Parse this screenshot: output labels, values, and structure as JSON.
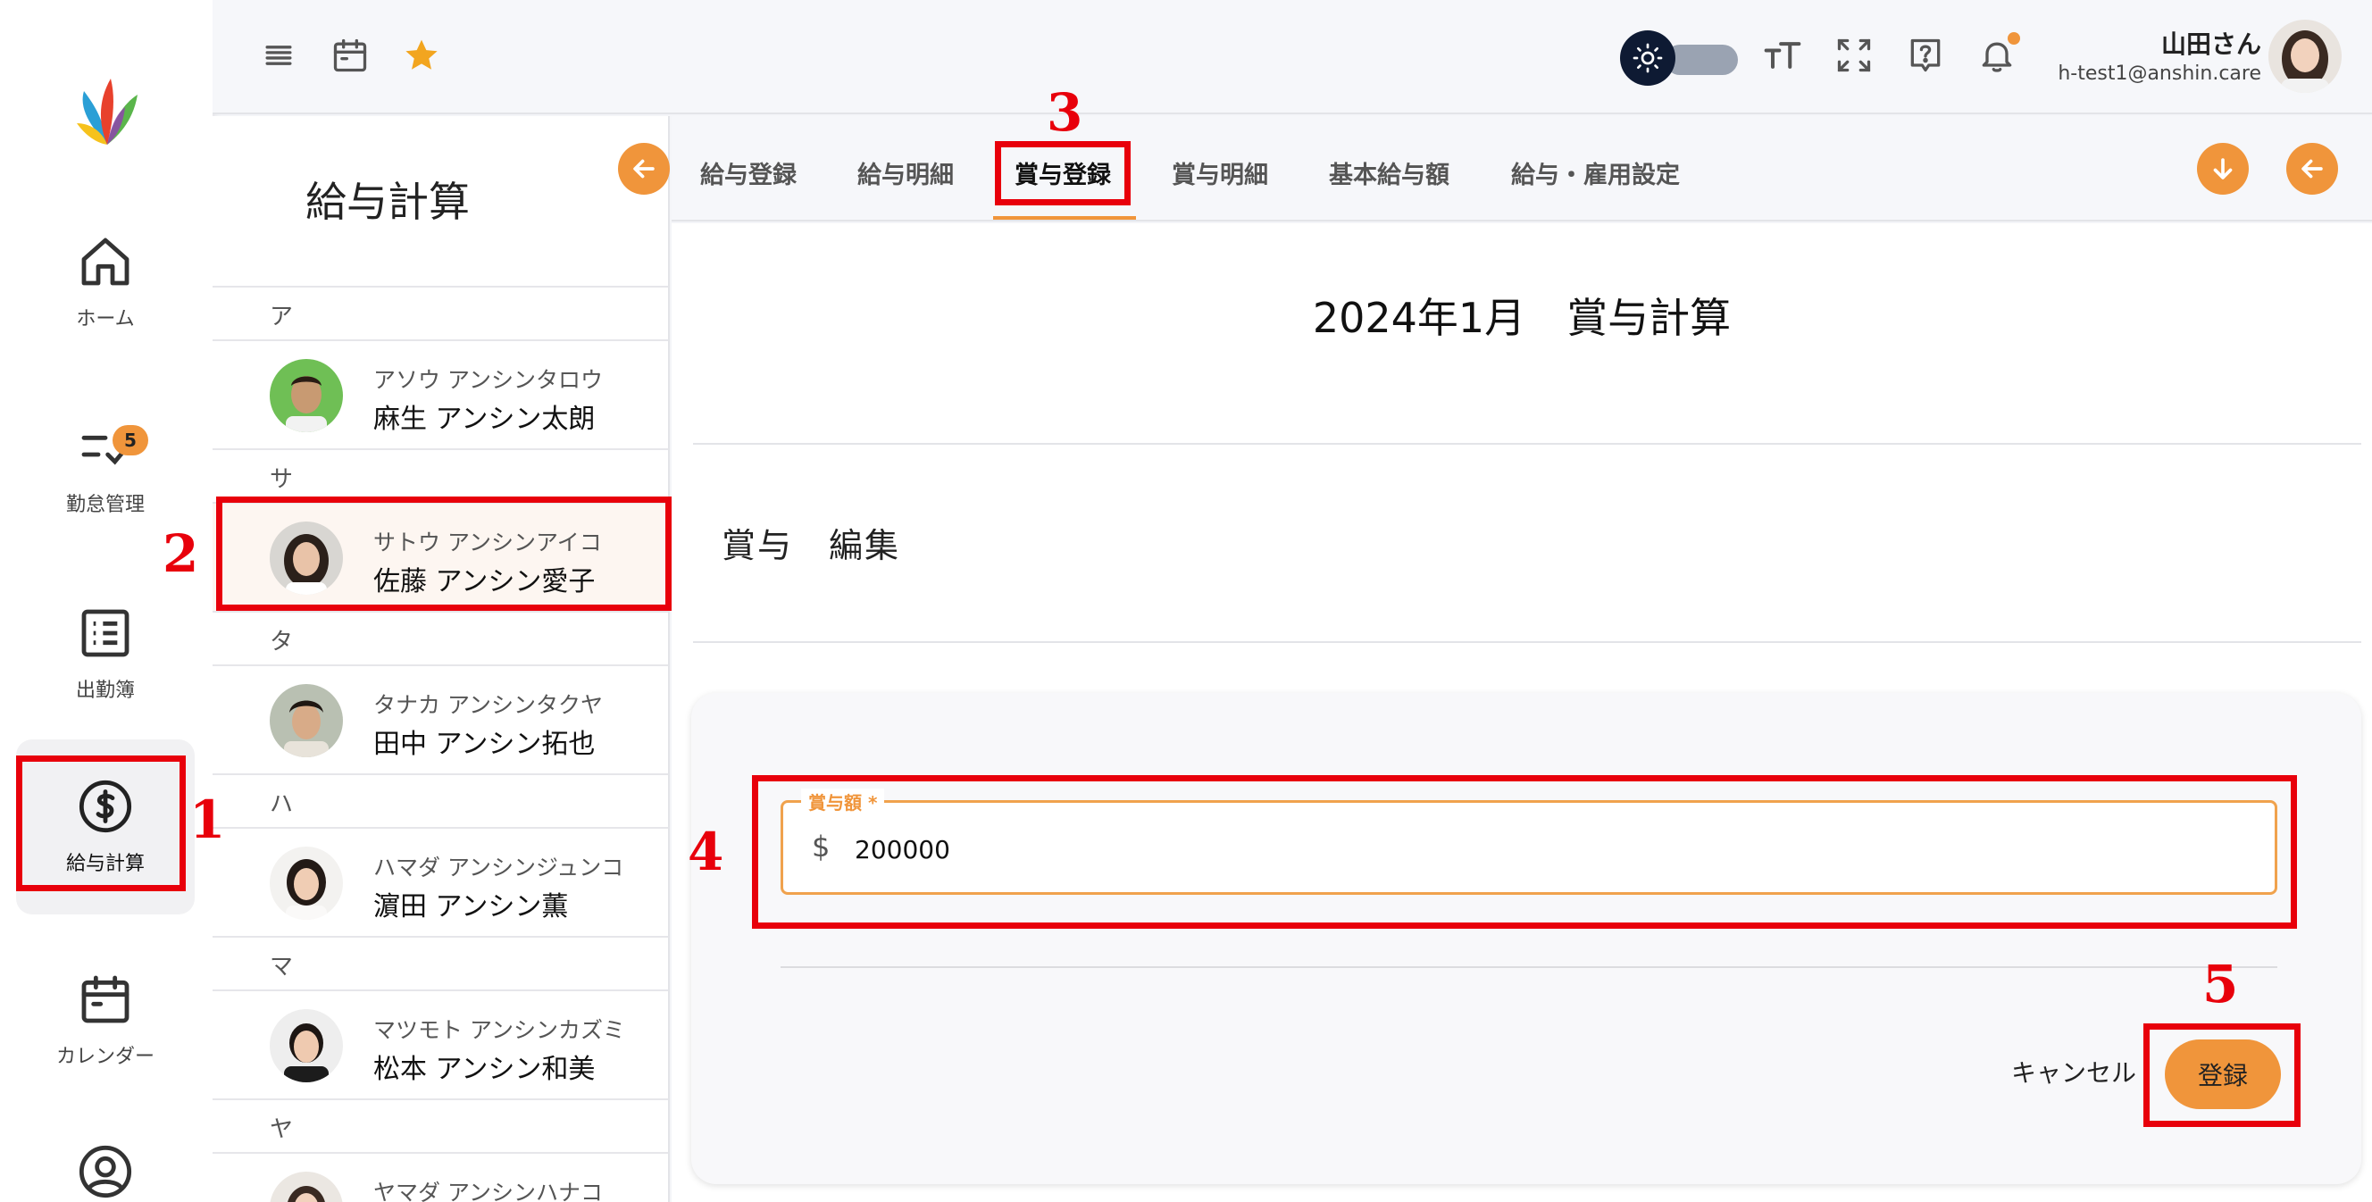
{
  "sidebar": {
    "items": [
      {
        "label": "ホーム",
        "icon": "home-icon"
      },
      {
        "label": "勤怠管理",
        "icon": "checklist-icon",
        "badge": "5"
      },
      {
        "label": "出勤簿",
        "icon": "list-icon"
      },
      {
        "label": "給与計算",
        "icon": "dollar-circle-icon"
      },
      {
        "label": "カレンダー",
        "icon": "calendar-icon"
      },
      {
        "label": "",
        "icon": "account-circle-icon"
      }
    ]
  },
  "header": {
    "user_name": "山田さん",
    "user_email": "h-test1@anshin.care"
  },
  "panel": {
    "title": "給与計算",
    "employees": [
      {
        "group": "ア",
        "kana": "アソウ アンシンタロウ",
        "name": "麻生 アンシン太朗"
      },
      {
        "group": "サ",
        "kana": "サトウ アンシンアイコ",
        "name": "佐藤 アンシン愛子"
      },
      {
        "group": "タ",
        "kana": "タナカ アンシンタクヤ",
        "name": "田中 アンシン拓也"
      },
      {
        "group": "ハ",
        "kana": "ハマダ アンシンジュンコ",
        "name": "濵田 アンシン薫"
      },
      {
        "group": "マ",
        "kana": "マツモト アンシンカズミ",
        "name": "松本 アンシン和美"
      },
      {
        "group": "ヤ",
        "kana": "ヤマダ アンシンハナコ",
        "name": ""
      }
    ]
  },
  "tabs": [
    "給与登録",
    "給与明細",
    "賞与登録",
    "賞与明細",
    "基本給与額",
    "給与・雇用設定"
  ],
  "main": {
    "period_title": "2024年1月　賞与計算",
    "section_title": "賞与　編集",
    "bonus_field": {
      "label": "賞与額 *",
      "prefix": "$",
      "value": "200000"
    },
    "cancel_label": "キャンセル",
    "save_label": "登録"
  },
  "annotations": {
    "steps": [
      "1",
      "2",
      "3",
      "4",
      "5"
    ]
  },
  "colors": {
    "accent": "#f0953b",
    "highlight": "#e8000b"
  }
}
